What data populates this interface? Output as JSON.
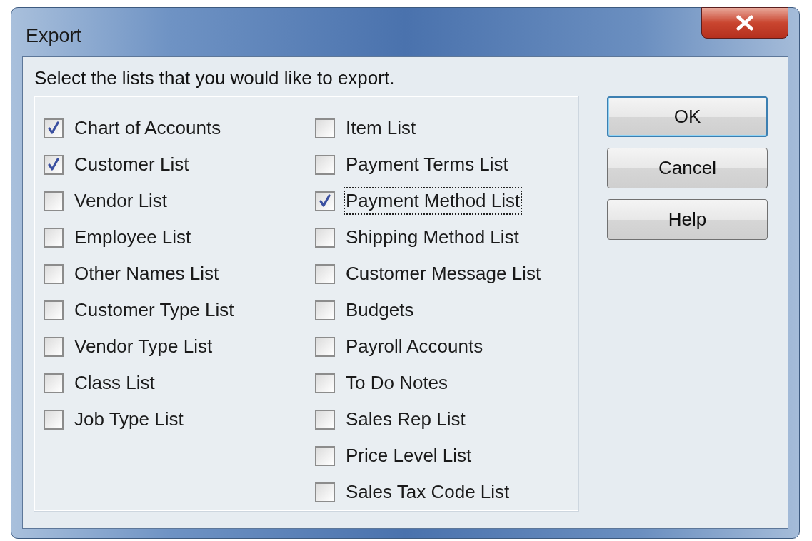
{
  "window": {
    "title": "Export"
  },
  "instruction": "Select the lists that you would like to export.",
  "columns": [
    [
      {
        "label": "Chart of Accounts",
        "checked": true,
        "focused": false
      },
      {
        "label": "Customer List",
        "checked": true,
        "focused": false
      },
      {
        "label": "Vendor List",
        "checked": false,
        "focused": false
      },
      {
        "label": "Employee List",
        "checked": false,
        "focused": false
      },
      {
        "label": "Other Names List",
        "checked": false,
        "focused": false
      },
      {
        "label": "Customer Type List",
        "checked": false,
        "focused": false
      },
      {
        "label": "Vendor Type List",
        "checked": false,
        "focused": false
      },
      {
        "label": "Class List",
        "checked": false,
        "focused": false
      },
      {
        "label": "Job Type List",
        "checked": false,
        "focused": false
      }
    ],
    [
      {
        "label": "Item List",
        "checked": false,
        "focused": false
      },
      {
        "label": "Payment Terms List",
        "checked": false,
        "focused": false
      },
      {
        "label": "Payment Method List",
        "checked": true,
        "focused": true
      },
      {
        "label": "Shipping Method List",
        "checked": false,
        "focused": false
      },
      {
        "label": "Customer Message List",
        "checked": false,
        "focused": false
      },
      {
        "label": "Budgets",
        "checked": false,
        "focused": false
      },
      {
        "label": "Payroll Accounts",
        "checked": false,
        "focused": false
      },
      {
        "label": "To Do Notes",
        "checked": false,
        "focused": false
      },
      {
        "label": "Sales Rep List",
        "checked": false,
        "focused": false
      },
      {
        "label": "Price Level List",
        "checked": false,
        "focused": false
      },
      {
        "label": "Sales Tax Code List",
        "checked": false,
        "focused": false
      }
    ]
  ],
  "buttons": [
    {
      "label": "OK",
      "default": true
    },
    {
      "label": "Cancel",
      "default": false
    },
    {
      "label": "Help",
      "default": false
    }
  ]
}
